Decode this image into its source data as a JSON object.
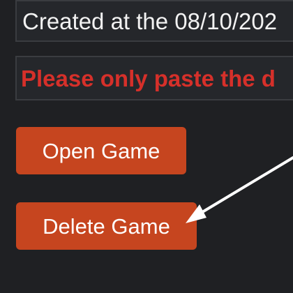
{
  "info": {
    "created_text": "Created at the 08/10/202"
  },
  "warning": {
    "text": "Please only paste the d"
  },
  "actions": {
    "open_label": "Open Game",
    "delete_label": "Delete Game"
  },
  "colors": {
    "background": "#1f2023",
    "button": "#c6451f",
    "warning_text": "#d6302a",
    "arrow": "#ffffff"
  },
  "annotation": {
    "icon": "arrow-pointer-icon"
  }
}
